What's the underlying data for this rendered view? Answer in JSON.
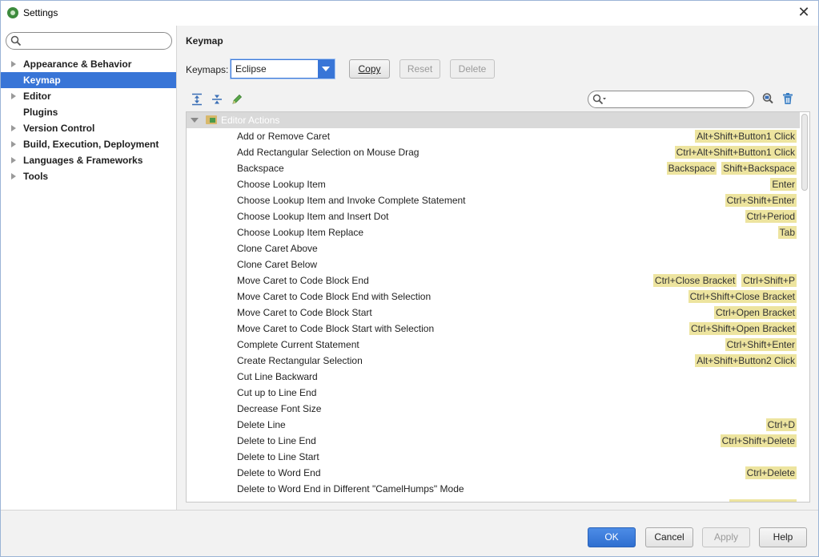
{
  "window": {
    "title": "Settings"
  },
  "sidebar": {
    "search_placeholder": "",
    "items": [
      {
        "label": "Appearance & Behavior",
        "expandable": true,
        "selected": false
      },
      {
        "label": "Keymap",
        "expandable": false,
        "selected": true
      },
      {
        "label": "Editor",
        "expandable": true,
        "selected": false
      },
      {
        "label": "Plugins",
        "expandable": false,
        "selected": false
      },
      {
        "label": "Version Control",
        "expandable": true,
        "selected": false
      },
      {
        "label": "Build, Execution, Deployment",
        "expandable": true,
        "selected": false
      },
      {
        "label": "Languages & Frameworks",
        "expandable": true,
        "selected": false
      },
      {
        "label": "Tools",
        "expandable": true,
        "selected": false
      }
    ]
  },
  "main": {
    "title": "Keymap",
    "keymaps_label": "Keymaps:",
    "keymap_selected": "Eclipse",
    "copy_label": "Copy",
    "reset_label": "Reset",
    "delete_label": "Delete",
    "action_search_placeholder": "",
    "tree_group": "Editor Actions",
    "actions": [
      {
        "name": "Add or Remove Caret",
        "shortcuts": [
          "Alt+Shift+Button1 Click"
        ]
      },
      {
        "name": "Add Rectangular Selection on Mouse Drag",
        "shortcuts": [
          "Ctrl+Alt+Shift+Button1 Click"
        ]
      },
      {
        "name": "Backspace",
        "shortcuts": [
          "Backspace",
          "Shift+Backspace"
        ]
      },
      {
        "name": "Choose Lookup Item",
        "shortcuts": [
          "Enter"
        ]
      },
      {
        "name": "Choose Lookup Item and Invoke Complete Statement",
        "shortcuts": [
          "Ctrl+Shift+Enter"
        ]
      },
      {
        "name": "Choose Lookup Item and Insert Dot",
        "shortcuts": [
          "Ctrl+Period"
        ]
      },
      {
        "name": "Choose Lookup Item Replace",
        "shortcuts": [
          "Tab"
        ]
      },
      {
        "name": "Clone Caret Above",
        "shortcuts": []
      },
      {
        "name": "Clone Caret Below",
        "shortcuts": []
      },
      {
        "name": "Move Caret to Code Block End",
        "shortcuts": [
          "Ctrl+Close Bracket",
          "Ctrl+Shift+P"
        ]
      },
      {
        "name": "Move Caret to Code Block End with Selection",
        "shortcuts": [
          "Ctrl+Shift+Close Bracket"
        ]
      },
      {
        "name": "Move Caret to Code Block Start",
        "shortcuts": [
          "Ctrl+Open Bracket"
        ]
      },
      {
        "name": "Move Caret to Code Block Start with Selection",
        "shortcuts": [
          "Ctrl+Shift+Open Bracket"
        ]
      },
      {
        "name": "Complete Current Statement",
        "shortcuts": [
          "Ctrl+Shift+Enter"
        ]
      },
      {
        "name": "Create Rectangular Selection",
        "shortcuts": [
          "Alt+Shift+Button2 Click"
        ]
      },
      {
        "name": "Cut Line Backward",
        "shortcuts": []
      },
      {
        "name": "Cut up to Line End",
        "shortcuts": []
      },
      {
        "name": "Decrease Font Size",
        "shortcuts": []
      },
      {
        "name": "Delete Line",
        "shortcuts": [
          "Ctrl+D"
        ]
      },
      {
        "name": "Delete to Line End",
        "shortcuts": [
          "Ctrl+Shift+Delete"
        ]
      },
      {
        "name": "Delete to Line Start",
        "shortcuts": []
      },
      {
        "name": "Delete to Word End",
        "shortcuts": [
          "Ctrl+Delete"
        ]
      },
      {
        "name": "Delete to Word End in Different \"CamelHumps\" Mode",
        "shortcuts": []
      }
    ]
  },
  "footer": {
    "ok_label": "OK",
    "cancel_label": "Cancel",
    "apply_label": "Apply",
    "help_label": "Help"
  },
  "colors": {
    "selection": "#3875d7",
    "shortcut_highlight": "#ede49f",
    "group_header": "#d9d9d9"
  }
}
